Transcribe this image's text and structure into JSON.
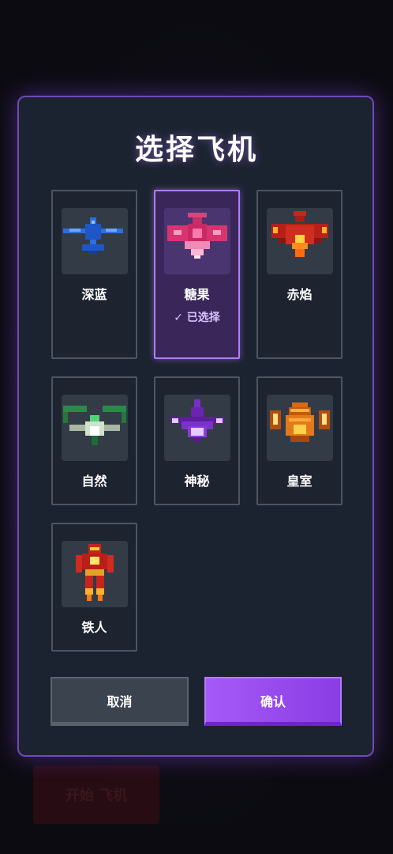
{
  "dialog": {
    "title": "选择飞机",
    "cancel_label": "取消",
    "confirm_label": "确认"
  },
  "background": {
    "button_label": "开始 飞机"
  },
  "planes": [
    {
      "name": "深蓝",
      "icon": "blue-jet-icon",
      "selected": false
    },
    {
      "name": "糖果",
      "icon": "candy-jet-icon",
      "selected": true,
      "selected_label": "✓ 已选择"
    },
    {
      "name": "赤焰",
      "icon": "flame-jet-icon",
      "selected": false
    },
    {
      "name": "自然",
      "icon": "nature-jet-icon",
      "selected": false
    },
    {
      "name": "神秘",
      "icon": "mystic-jet-icon",
      "selected": false
    },
    {
      "name": "皇室",
      "icon": "royal-jet-icon",
      "selected": false
    },
    {
      "name": "铁人",
      "icon": "ironman-icon",
      "selected": false
    }
  ],
  "colors": {
    "accent": "#a55af7",
    "dialog_border": "#6e4ab5",
    "selected_border": "#b07cff",
    "selected_text": "#d8c2ff"
  }
}
